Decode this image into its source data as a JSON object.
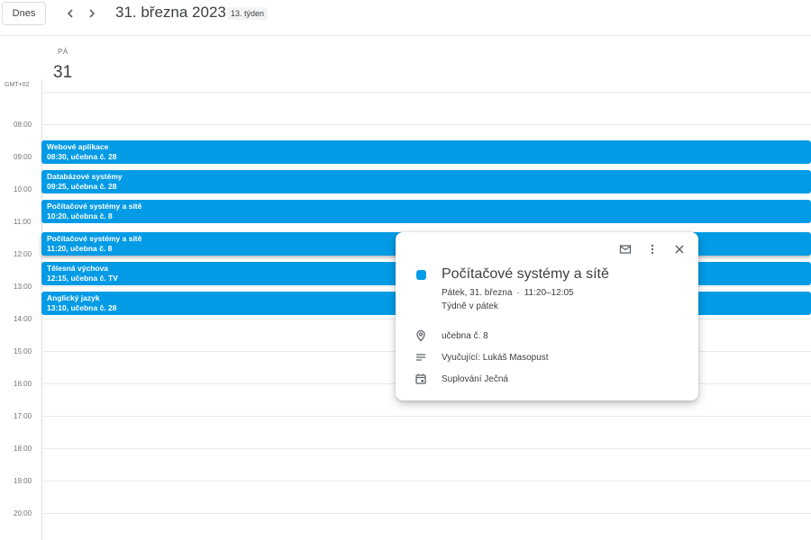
{
  "header": {
    "today_label": "Dnes",
    "date_title": "31. března 2023",
    "week_badge": "13. týden"
  },
  "day": {
    "name": "PÁ",
    "number": "31"
  },
  "timezone": "GMT+02",
  "hours": [
    "08:00",
    "09:00",
    "10:00",
    "11:00",
    "12:00",
    "13:00",
    "14:00",
    "15:00",
    "16:00",
    "17:00",
    "18:00",
    "19:00",
    "20:00"
  ],
  "events": [
    {
      "title": "Webové aplikace",
      "subtitle": "08:30, učebna č. 28"
    },
    {
      "title": "Databázové systémy",
      "subtitle": "09:25, učebna č. 28"
    },
    {
      "title": "Počítačové systémy a sítě",
      "subtitle": "10:20, učebna č. 8"
    },
    {
      "title": "Počítačové systémy a sítě",
      "subtitle": "11:20, učebna č. 8"
    },
    {
      "title": "Tělesná výchova",
      "subtitle": "12:15, učebna č. TV"
    },
    {
      "title": "Anglický jazyk",
      "subtitle": "13:10, učebna č. 28"
    }
  ],
  "popup": {
    "title": "Počítačové systémy a sítě",
    "date": "Pátek, 31. března",
    "dot": "·",
    "time": "11:20–12:05",
    "repeat": "Týdně v pátek",
    "location": "učebna č. 8",
    "description": "Vyučující: Lukáš Masopust",
    "calendar": "Suplování Ječná"
  },
  "colors": {
    "event": "#039be5"
  },
  "icons": {
    "prev": "chevron-left-icon",
    "next": "chevron-right-icon",
    "email": "email-icon",
    "more": "more-vert-icon",
    "close": "close-icon",
    "location": "location-pin-icon",
    "description": "notes-icon",
    "calendar": "calendar-icon"
  }
}
